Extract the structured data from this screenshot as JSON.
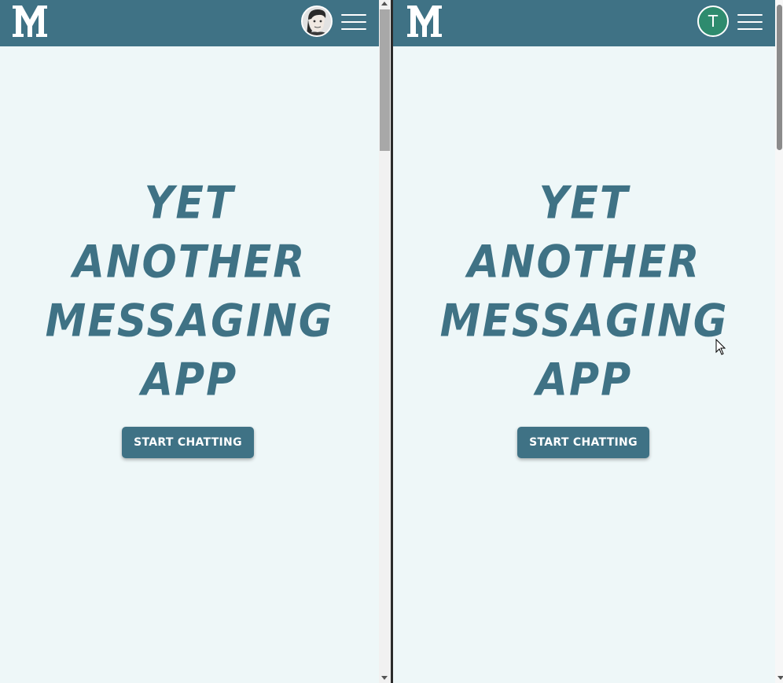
{
  "brand": {
    "logo_text": "M"
  },
  "panes": [
    {
      "avatar_kind": "photo",
      "avatar_initial": "",
      "hero_lines": [
        "YET",
        "ANOTHER",
        "MESSAGING",
        "APP"
      ],
      "cta_label": "START CHATTING"
    },
    {
      "avatar_kind": "initial",
      "avatar_initial": "T",
      "hero_lines": [
        "YET",
        "ANOTHER",
        "MESSAGING",
        "APP"
      ],
      "cta_label": "START CHATTING"
    }
  ],
  "colors": {
    "navbar": "#3f7285",
    "background": "#eef7f8",
    "accent_text": "#3f7285",
    "avatar_green": "#2e8b6e"
  },
  "icons": {
    "logo": "ym-logo-icon",
    "menu": "hamburger-menu-icon",
    "avatar_photo": "user-photo-avatar",
    "cursor": "mouse-pointer-icon"
  }
}
